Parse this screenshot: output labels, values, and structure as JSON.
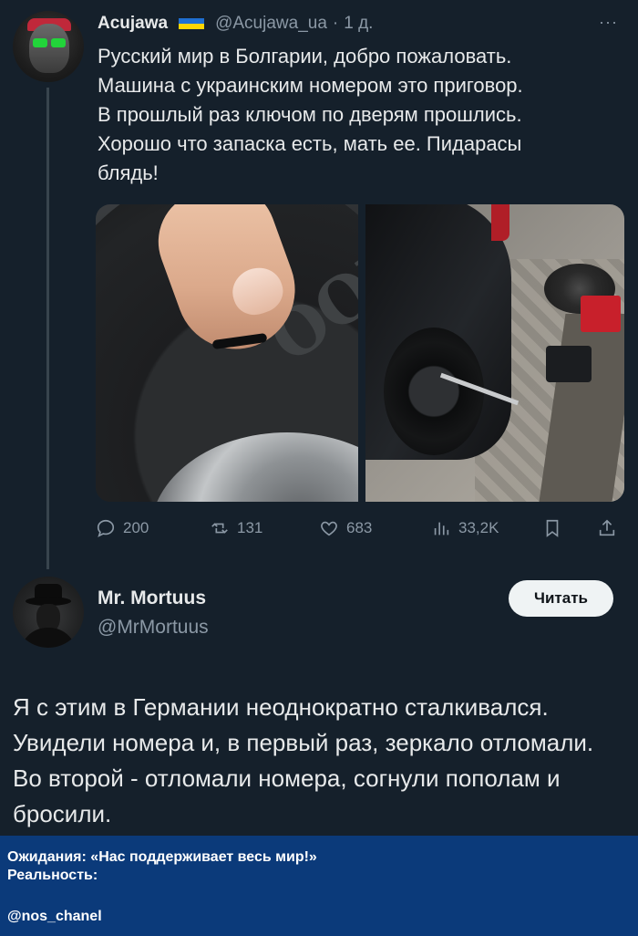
{
  "tweet1": {
    "name": "Acujawa",
    "handle": "@Acujawa_ua",
    "dot": "·",
    "time": "1 д.",
    "text": "Русский мир в Болгарии, добро пожаловать.\nМашина с украинским номером это приговор.\nВ прошлый раз ключом по дверям прошлись.\nХорошо что запаска есть, мать ее. Пидарасы\nблядь!",
    "tire_lettering": "OODYEA",
    "stats": {
      "replies": "200",
      "retweets": "131",
      "likes": "683",
      "views": "33,2K"
    }
  },
  "tweet2": {
    "name": "Mr. Mortuus",
    "handle": "@MrMortuus",
    "follow_label": "Читать",
    "text": "Я с этим в Германии неоднократно сталкивался. Увидели номера и, в первый раз, зеркало отломали. Во второй - отломали номера, согнули пополам и бросили."
  },
  "caption": {
    "line1": "Ожидания: «Нас поддерживает весь мир!»",
    "line2": "Реальность:",
    "credit": "@nos_chanel"
  },
  "colors": {
    "background": "#15202b",
    "text": "#e7e9ea",
    "muted": "#8b98a5",
    "caption_bg": "#0b3a7a"
  }
}
